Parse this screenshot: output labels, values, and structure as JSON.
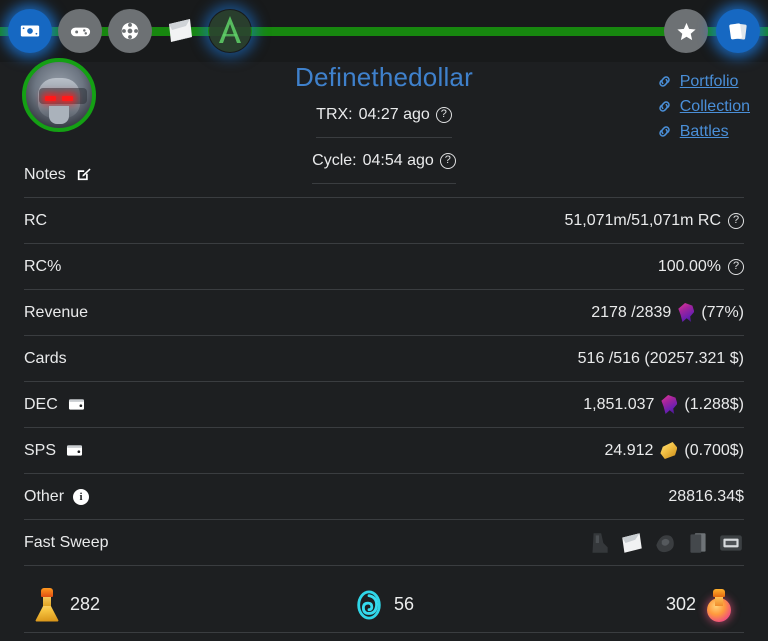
{
  "theme": {
    "background": "#1d1f21",
    "topbar_bg": "#181a1b",
    "accent_green": "#17870f",
    "accent_blue": "#3f81cc",
    "divider": "#3a3d40",
    "text": "#e9eaeb"
  },
  "topnav": {
    "left_items": [
      {
        "name": "money-icon",
        "label": "Money",
        "style": "blue",
        "active": true
      },
      {
        "name": "gamepad-icon",
        "label": "Battles",
        "style": "gray",
        "active": false
      },
      {
        "name": "settings-icon",
        "label": "Settings",
        "style": "gray",
        "active": false
      },
      {
        "name": "card-pack-icon",
        "label": "Packs",
        "style": "plain",
        "active": false
      },
      {
        "name": "splinterlands-a-logo",
        "label": "A",
        "style": "plain",
        "active": true
      }
    ],
    "right_items": [
      {
        "name": "star-icon",
        "label": "Favorites",
        "style": "gray",
        "active": false
      },
      {
        "name": "cards-icon",
        "label": "Cards",
        "style": "blue",
        "active": true
      }
    ]
  },
  "header": {
    "username": "Definethedollar",
    "avatar_name": "player-avatar",
    "trx_label": "TRX:",
    "trx_value": "04:27 ago",
    "cycle_label": "Cycle:",
    "cycle_value": "04:54 ago",
    "help_glyph": "?",
    "links": [
      {
        "label": "Portfolio",
        "icon": "link-icon"
      },
      {
        "label": "Collection",
        "icon": "link-icon"
      },
      {
        "label": "Battles",
        "icon": "link-icon"
      }
    ]
  },
  "rows": [
    {
      "id": "notes",
      "label": "Notes",
      "label_icon": "edit-pencil-icon",
      "value": "",
      "value_icon": null
    },
    {
      "id": "rc",
      "label": "RC",
      "label_icon": null,
      "value": "51,071m/51,071m RC",
      "value_icon": "help-icon"
    },
    {
      "id": "rc-percent",
      "label": "RC%",
      "label_icon": null,
      "value": "100.00%",
      "value_icon": "help-icon"
    },
    {
      "id": "revenue",
      "label": "Revenue",
      "label_icon": null,
      "value": "2178 /2839",
      "value_icon": "dec-gem-icon",
      "value_suffix": "(77%)"
    },
    {
      "id": "cards",
      "label": "Cards",
      "label_icon": null,
      "value": "516 /516 (20257.321 $)",
      "value_icon": null
    },
    {
      "id": "dec",
      "label": "DEC",
      "label_icon": "wallet-icon",
      "value": "1,851.037",
      "value_icon": "dec-gem-icon",
      "value_suffix": "(1.288$)"
    },
    {
      "id": "sps",
      "label": "SPS",
      "label_icon": "wallet-icon",
      "value": "24.912",
      "value_icon": "sps-shard-icon",
      "value_suffix": "(0.700$)"
    },
    {
      "id": "other",
      "label": "Other",
      "label_icon": "info-icon",
      "value": "28816.34$",
      "value_icon": null
    },
    {
      "id": "fast-sweep",
      "label": "Fast Sweep",
      "label_icon": null,
      "value": "",
      "value_icon": null,
      "sweep_icons": [
        "dark-boot-item-icon",
        "white-scroll-item-icon",
        "dark-relic-item-icon",
        "dark-card-stack-icon",
        "dark-frame-item-icon"
      ]
    }
  ],
  "bottom_bar": {
    "items": [
      {
        "icon": "gold-potion-icon",
        "value": "282",
        "order": "icon-first"
      },
      {
        "icon": "teal-spiral-icon",
        "value": "56",
        "order": "icon-first"
      },
      {
        "icon": "pink-potion-icon",
        "value": "302",
        "order": "value-first"
      }
    ]
  }
}
